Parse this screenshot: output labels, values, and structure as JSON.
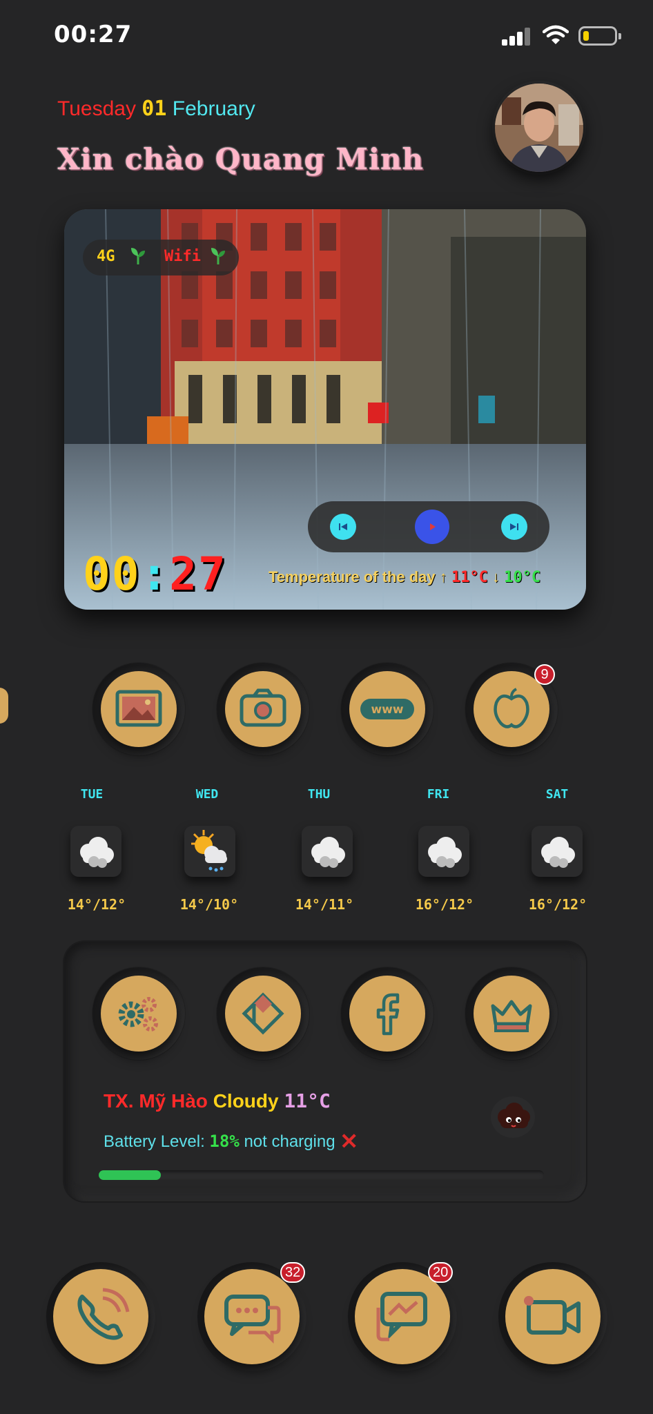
{
  "status_bar": {
    "time": "00:27",
    "signal_icon": "cellular-signal-icon",
    "wifi_icon": "wifi-icon",
    "battery_icon": "battery-icon"
  },
  "header": {
    "day": "Tuesday",
    "date": "01",
    "month": "February",
    "greeting": "Xin chào Quang Minh"
  },
  "hero": {
    "network": {
      "cell": "4G",
      "wifi": "Wifi"
    },
    "clock": {
      "hours": "00",
      "sep": ":",
      "minutes": "27"
    },
    "temperature": {
      "label": "Temperature of the day",
      "high_arrow": "↑",
      "high": "11°C",
      "low_arrow": "↓",
      "low": "10°C"
    },
    "player": {
      "prev_icon": "previous-track-icon",
      "play_icon": "play-icon",
      "next_icon": "next-track-icon"
    }
  },
  "app_row_1": [
    {
      "icon": "photos-icon"
    },
    {
      "icon": "camera-icon"
    },
    {
      "icon": "www-browser-icon"
    },
    {
      "icon": "apple-icon",
      "badge": "9"
    }
  ],
  "weather": [
    {
      "day": "TUE",
      "icon": "cloudy-icon",
      "temp": "14°/12°"
    },
    {
      "day": "WED",
      "icon": "partly-sunny-rain-icon",
      "temp": "14°/10°"
    },
    {
      "day": "THU",
      "icon": "cloudy-icon",
      "temp": "14°/11°"
    },
    {
      "day": "FRI",
      "icon": "cloudy-icon",
      "temp": "16°/12°"
    },
    {
      "day": "SAT",
      "icon": "cloudy-icon",
      "temp": "16°/12°"
    }
  ],
  "app_row_2": [
    {
      "icon": "settings-gears-icon"
    },
    {
      "icon": "kodi-icon"
    },
    {
      "icon": "facebook-icon"
    },
    {
      "icon": "crown-icon"
    }
  ],
  "info": {
    "location": "TX. Mỹ Hào",
    "condition": "Cloudy",
    "temp": "11°C",
    "battery_label": "Battery Level:",
    "battery_value": "18%",
    "battery_status": "not charging",
    "status_mark": "✕",
    "battery_fraction": 0.14
  },
  "dock": [
    {
      "icon": "phone-icon"
    },
    {
      "icon": "messages-icon",
      "badge": "32"
    },
    {
      "icon": "messenger-icon",
      "badge": "20"
    },
    {
      "icon": "facetime-video-icon"
    }
  ],
  "colors": {
    "icon_gold": "#d6a85e",
    "icon_line": "#2e6b66",
    "badge_red": "#c81f2c",
    "background": "#252526"
  }
}
